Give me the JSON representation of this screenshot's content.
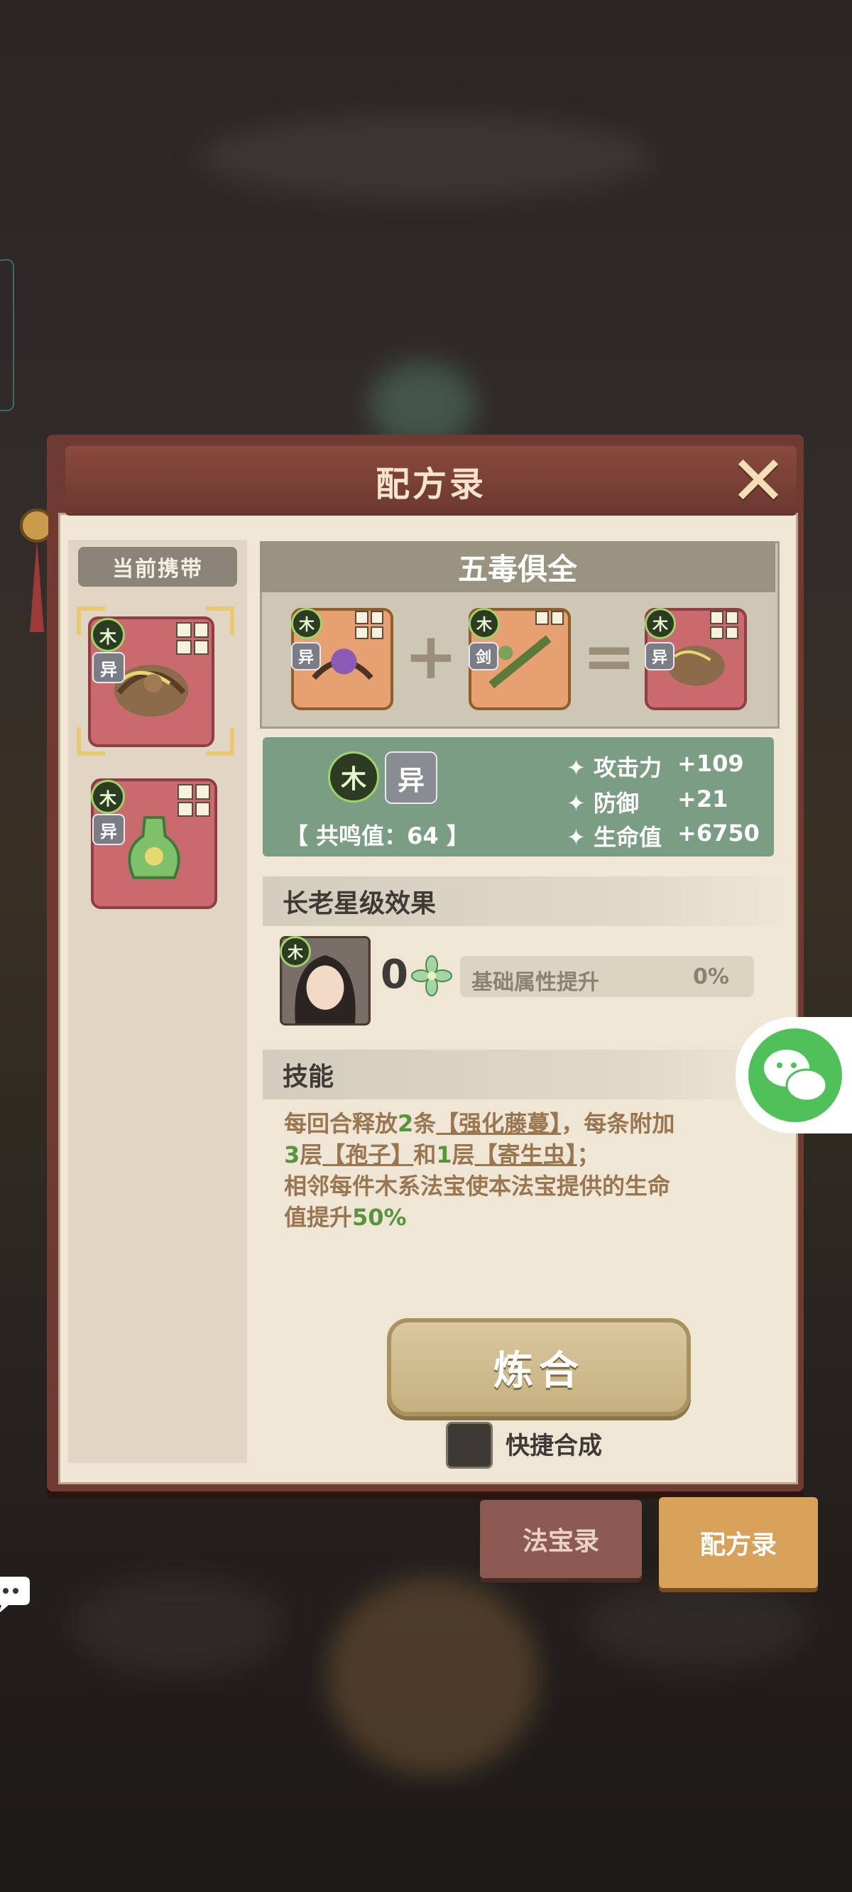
{
  "panel": {
    "title": "配方录",
    "close_label": "✕"
  },
  "left": {
    "header": "当前携带",
    "cards": [
      {
        "element": "木",
        "type": "异"
      },
      {
        "element": "木",
        "type": "异"
      }
    ]
  },
  "recipe": {
    "name": "五毒俱全",
    "inputs": [
      {
        "element": "木",
        "type": "异"
      },
      {
        "element": "木",
        "type": "剑"
      }
    ],
    "result": {
      "element": "木",
      "type": "异"
    },
    "plus": "+",
    "equals": "="
  },
  "stats": {
    "element": "木",
    "type": "异",
    "resonance": "【 共鸣值：64 】",
    "attack_label": "攻击力",
    "attack_value": "+109",
    "defense_label": "防御",
    "defense_value": "+21",
    "hp_label": "生命值",
    "hp_value": "+6750"
  },
  "elder": {
    "section_title": "长老星级效果",
    "element": "木",
    "stars": "0",
    "bonus_label": "基础属性提升",
    "bonus_value": "0%"
  },
  "skill": {
    "section_title": "技能",
    "l1a": "每回合释放",
    "l1b": "2",
    "l1c": "条",
    "l1d": "【强化藤蔓】",
    "l1e": "，每条附加",
    "l2a": "3",
    "l2b": "层",
    "l2c": "【孢子】",
    "l2d": "和",
    "l2e": "1",
    "l2f": "层",
    "l2g": "【寄生虫】",
    "l2h": "；",
    "l3": "相邻每件木系法宝使本法宝提供的生命",
    "l4a": "值提升",
    "l4b": "50%"
  },
  "actions": {
    "refine_button": "炼合",
    "quick_label": "快捷合成"
  },
  "tabs": {
    "treasure": "法宝录",
    "recipe": "配方录"
  },
  "colors": {
    "panel_frame": "#6e3a31",
    "paper": "#efe6d6",
    "stat_green": "#7a9d84",
    "accent_green": "#58943e",
    "card_red": "#c96a6e",
    "card_orange": "#e6a072",
    "tab_active": "#d9a25a",
    "tab_inactive": "#8d5a52"
  }
}
